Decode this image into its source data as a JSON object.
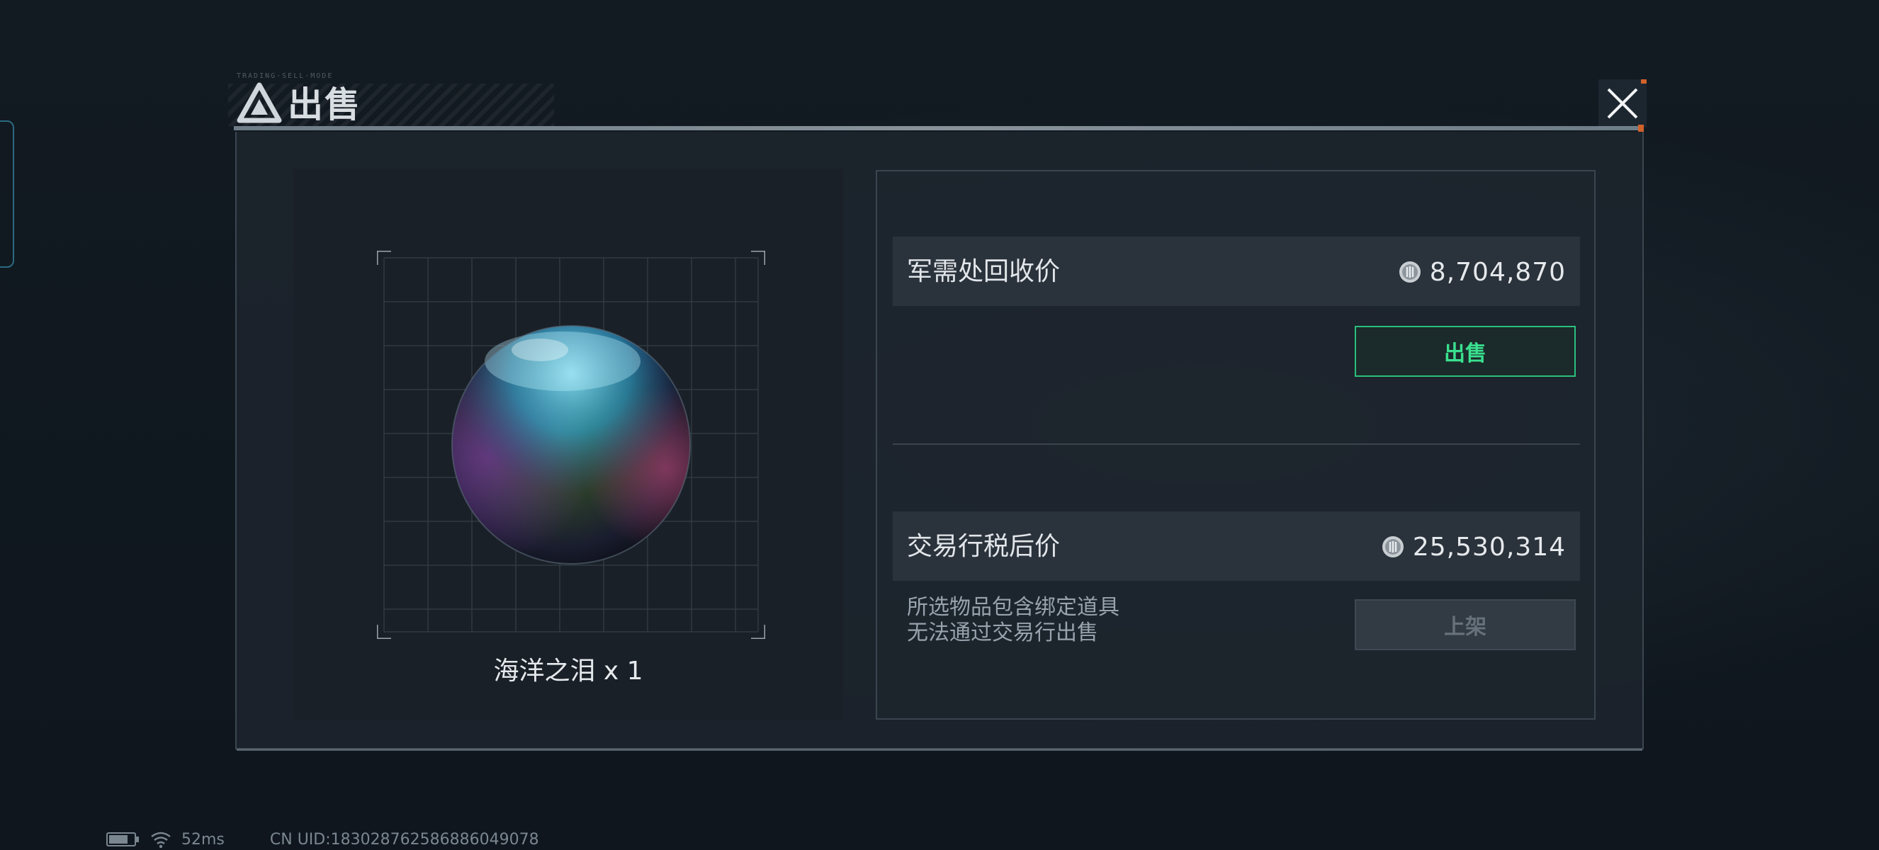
{
  "dialog": {
    "title": "出售",
    "title_small_text": "TRADING·SELL·MODE"
  },
  "item": {
    "name": "海洋之泪 x 1",
    "icon": "pearl-orb-image"
  },
  "recycle": {
    "label": "军需处回收价",
    "price": "8,704,870",
    "button_label": "出售"
  },
  "exchange": {
    "label": "交易行税后价",
    "price": "25,530,314",
    "notice_line1": "所选物品包含绑定道具",
    "notice_line2": "无法通过交易行出售",
    "button_label": "上架",
    "button_enabled": false
  },
  "status": {
    "ping": "52ms",
    "uid": "CN UID:183028762586886049078"
  },
  "colors": {
    "accent_green": "#3ae08f",
    "panel_bg": "#1c242c",
    "disabled_text": "#66717b",
    "close_accent": "#d2622a"
  }
}
